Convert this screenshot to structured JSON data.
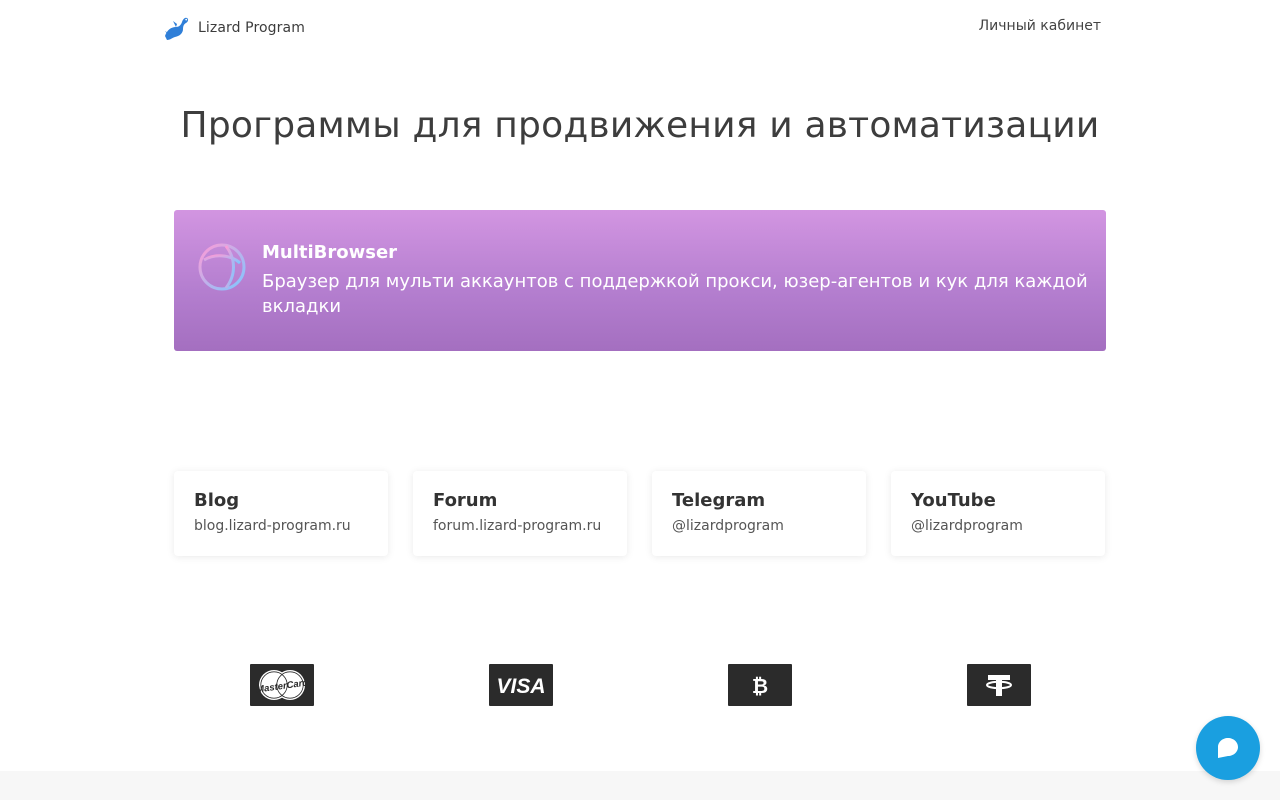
{
  "header": {
    "brand_name": "Lizard Program",
    "brand_logo_icon": "lizard-logo-icon",
    "account_link": "Личный кабинет"
  },
  "page_title": "Программы для продвижения и автоматизации",
  "products": [
    {
      "name": "MultiBrowser",
      "description": "Браузер для мульти аккаунтов с поддержкой прокси, юзер-агентов и кук для каждой вкладки",
      "icon": "browser-ball-icon",
      "gradient_top": "#d295e1",
      "gradient_bottom": "#a46fc0"
    }
  ],
  "links": [
    {
      "title": "Blog",
      "subtitle": "blog.lizard-program.ru"
    },
    {
      "title": "Forum",
      "subtitle": "forum.lizard-program.ru"
    },
    {
      "title": "Telegram",
      "subtitle": "@lizardprogram"
    },
    {
      "title": "YouTube",
      "subtitle": "@lizardprogram"
    }
  ],
  "payments": [
    {
      "name": "MasterCard",
      "icon": "mastercard-icon"
    },
    {
      "name": "VISA",
      "icon": "visa-icon"
    },
    {
      "name": "Bitcoin",
      "icon": "bitcoin-icon"
    },
    {
      "name": "Tether",
      "icon": "tether-icon"
    }
  ],
  "chat": {
    "icon": "chat-bubble-icon",
    "color": "#1a9fe0"
  }
}
